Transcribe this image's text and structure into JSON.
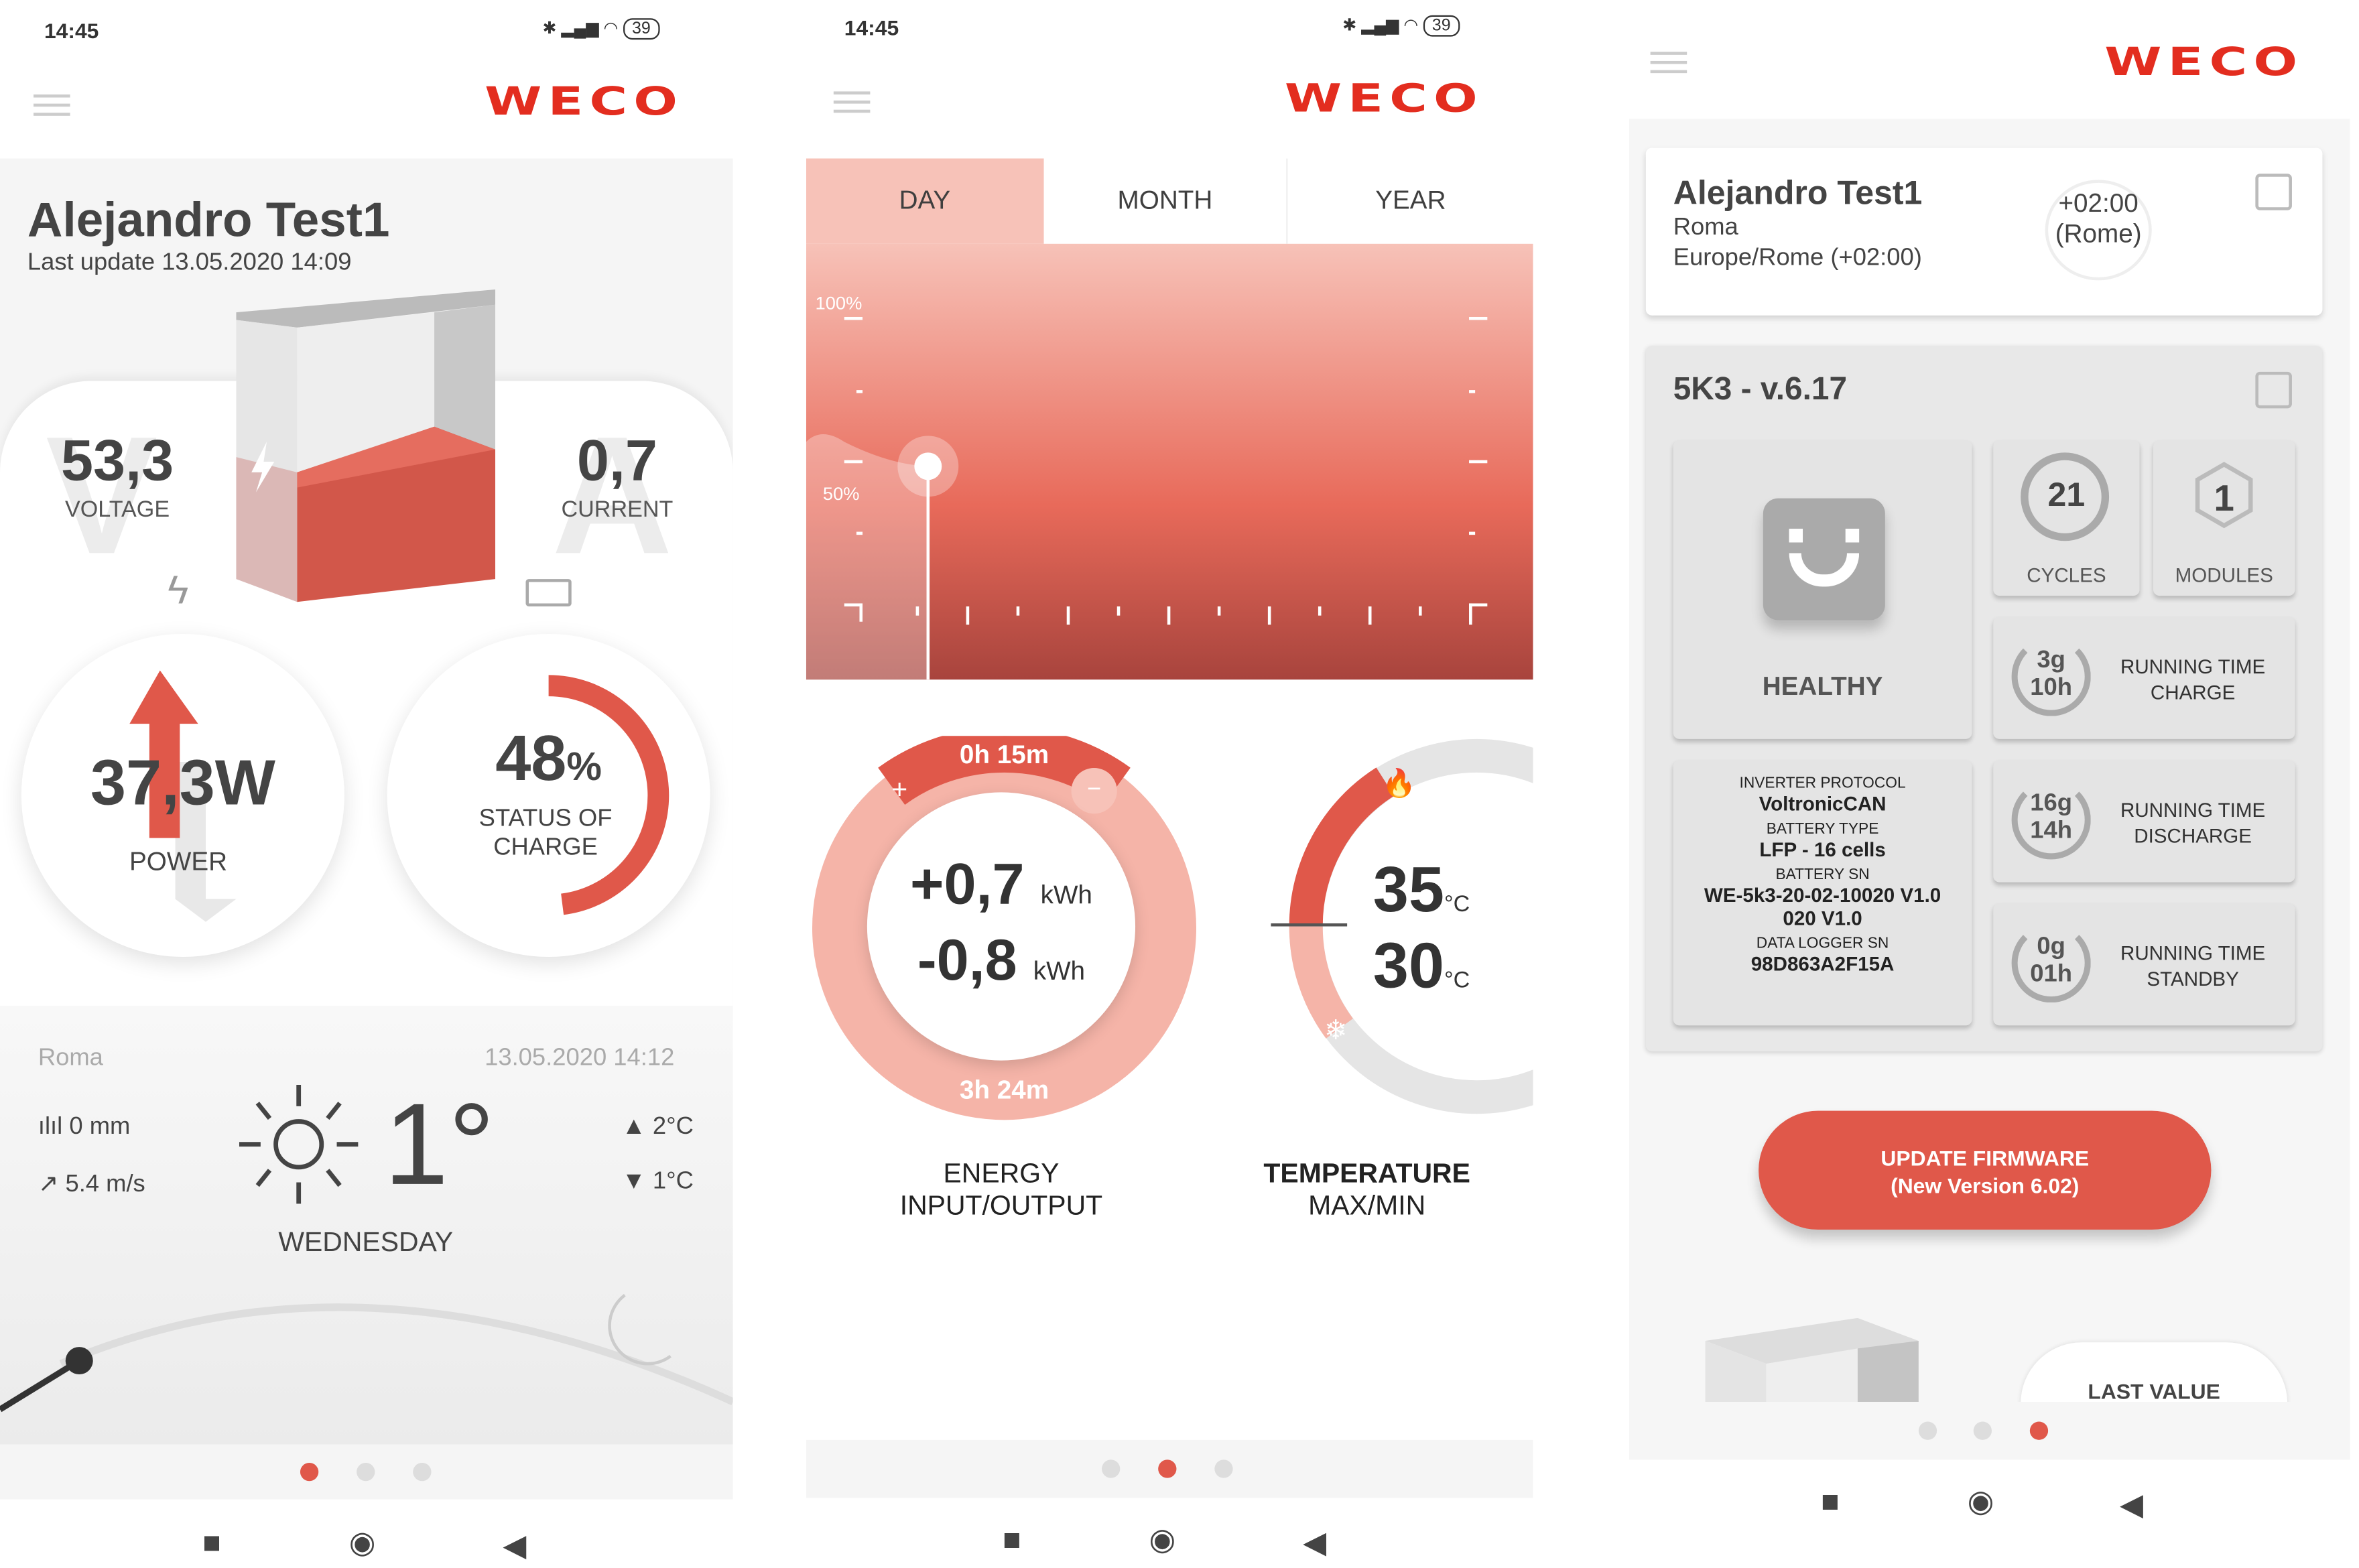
{
  "colors": {
    "accent": "#e0584a",
    "brand": "#e32d1f"
  },
  "status_bar": {
    "time": "14:45",
    "battery": "39"
  },
  "brand": "WECO",
  "screen1": {
    "title": "Alejandro Test1",
    "last_update": "Last update 13.05.2020 14:09",
    "voltage": {
      "value": "53,3",
      "label": "VOLTAGE",
      "bg_letter": "V"
    },
    "current": {
      "value": "0,7",
      "label": "CURRENT",
      "bg_letter": "A"
    },
    "power": {
      "value": "37,3W",
      "label": "POWER"
    },
    "soc": {
      "value": "48",
      "unit": "%",
      "label1": "STATUS OF",
      "label2": "CHARGE",
      "percent": 48
    },
    "weather": {
      "city": "Roma",
      "datetime": "13.05.2020 14:12",
      "rain": "0 mm",
      "wind": "5.4 m/s",
      "temp": "1°",
      "max": "2°C",
      "min": "1°C",
      "day": "WEDNESDAY",
      "icon": "sun-icon"
    }
  },
  "screen2": {
    "tabs": [
      {
        "label": "DAY",
        "active": true
      },
      {
        "label": "MONTH"
      },
      {
        "label": "YEAR"
      }
    ],
    "chart_labels": {
      "top": "100%",
      "mid": "50%"
    },
    "energy": {
      "top_time": "0h 15m",
      "input": "+0,7",
      "output": "-0,8",
      "unit": "kWh",
      "bottom_time": "3h 24m",
      "label1": "ENERGY",
      "label2": "INPUT/OUTPUT",
      "plus": "+",
      "minus": "−"
    },
    "temperature": {
      "max": "35",
      "min": "30",
      "unit": "°C",
      "label1": "TEMPERATURE",
      "label2": "MAX/MIN"
    }
  },
  "screen3": {
    "user": {
      "name": "Alejandro Test1",
      "city": "Roma",
      "timezone": "Europe/Rome (+02:00)",
      "offset": "+02:00",
      "zone": "(Rome)"
    },
    "device": {
      "title": "5K3 - v.6.17",
      "health": "HEALTHY",
      "cycles": "21",
      "cycles_label": "CYCLES",
      "modules": "1",
      "modules_label": "MODULES",
      "info": [
        {
          "label": "INVERTER PROTOCOL",
          "value": "VoltronicCAN"
        },
        {
          "label": "BATTERY TYPE",
          "value": "LFP - 16 cells"
        },
        {
          "label": "BATTERY SN",
          "value": "WE-5k3-20-02-10020 V1.0 020 V1.0"
        },
        {
          "label": "DATA LOGGER SN",
          "value": "98D863A2F15A"
        }
      ],
      "running": [
        {
          "d": "3g",
          "h": "10h",
          "label1": "RUNNING TIME",
          "label2": "CHARGE"
        },
        {
          "d": "16g",
          "h": "14h",
          "label1": "RUNNING TIME",
          "label2": "DISCHARGE"
        },
        {
          "d": "0g",
          "h": "01h",
          "label1": "RUNNING TIME",
          "label2": "STANDBY"
        }
      ]
    },
    "update_button": {
      "line1": "UPDATE FIRMWARE",
      "line2": "(New Version 6.02)"
    },
    "last_value": "LAST VALUE"
  },
  "pager": {
    "screen1_active": 0,
    "screen2_active": 1,
    "screen3_active": 2
  }
}
